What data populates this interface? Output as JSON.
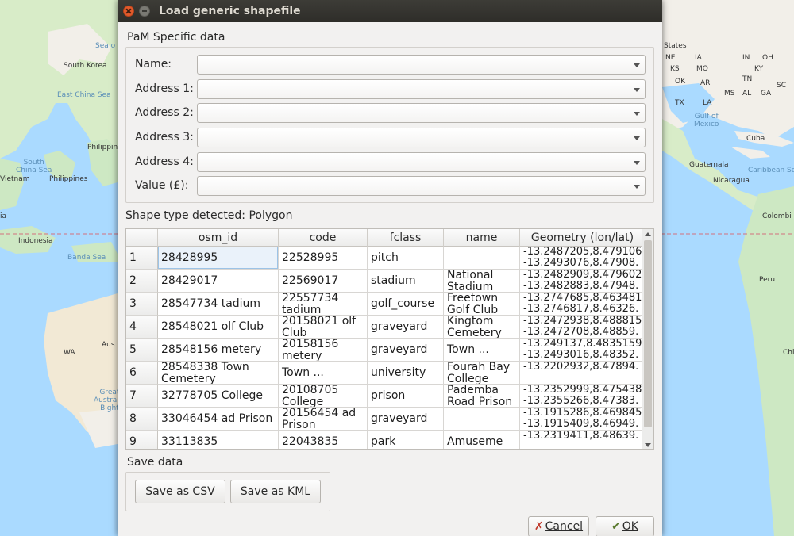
{
  "window": {
    "title": "Load generic shapefile"
  },
  "map": {
    "labels": {
      "sea_of_japan": "Sea o",
      "south_korea": "South Korea",
      "east_china_sea": "East China Sea",
      "philippine": "Philippin",
      "south_china_sea": "South\nChina Sea",
      "vietnam": "Vietnam",
      "philippines": "Philippines",
      "indonesia": "Indonesia",
      "banda_sea": "Banda Sea",
      "aus": "Aus",
      "wa": "WA",
      "great_australian_bight": "Great\nAustralia\nBight",
      "states": "States",
      "ne": "NE",
      "ia": "IA",
      "ks": "KS",
      "mo": "MO",
      "ok": "OK",
      "ar": "AR",
      "tx": "TX",
      "la": "LA",
      "in": "IN",
      "oh": "OH",
      "ky": "KY",
      "tn": "TN",
      "ms": "MS",
      "al": "AL",
      "ga": "GA",
      "sc": "SC",
      "gulf_of_mexico": "Gulf of\nMexico",
      "cuba": "Cuba",
      "guatemala": "Guatemala",
      "caribbean_sea": "Caribbean Se",
      "nicaragua": "Nicaragua",
      "colombi": "Colombi",
      "peru": "Peru",
      "chi": "Chi",
      "ia_left": "ia"
    }
  },
  "pam": {
    "group_title": "PaM Specific data",
    "fields": [
      {
        "label": "Name:",
        "value": ""
      },
      {
        "label": "Address 1:",
        "value": ""
      },
      {
        "label": "Address 2:",
        "value": ""
      },
      {
        "label": "Address 3:",
        "value": ""
      },
      {
        "label": "Address 4:",
        "value": ""
      },
      {
        "label": "Value (£):",
        "value": ""
      }
    ]
  },
  "shape": {
    "label": "Shape type detected:",
    "value": "Polygon"
  },
  "table": {
    "columns": [
      "osm_id",
      "code",
      "fclass",
      "name",
      "Geometry (lon/lat)"
    ],
    "rows": [
      {
        "num": "1",
        "osm_id": "28428995",
        "code": "22528995",
        "fclass": "pitch",
        "name": "",
        "geometry": "-13.2487205,8.479106\n-13.2493076,8.47908."
      },
      {
        "num": "2",
        "osm_id": "28429017",
        "code": "22569017",
        "fclass": "stadium",
        "name": "National\nStadium",
        "geometry": "-13.2482909,8.479602\n-13.2482883,8.47948."
      },
      {
        "num": "3",
        "osm_id": "28547734  tadium",
        "code": "22557734\ntadium",
        "fclass": "golf_course",
        "name": "Freetown\nGolf Club",
        "geometry": "-13.2747685,8.463481\n-13.2746817,8.46326."
      },
      {
        "num": "4",
        "osm_id": "28548021  olf Club",
        "code": "20158021  olf\nClub",
        "fclass": "graveyard",
        "name": "Kingtom\nCemetery",
        "geometry": "-13.2472938,8.488815\n-13.2472708,8.48859."
      },
      {
        "num": "5",
        "osm_id": "28548156  metery",
        "code": "20158156\nmetery",
        "fclass": "graveyard",
        "name": "Town ...",
        "geometry": "-13.249137,8.4835159\n-13.2493016,8.48352."
      },
      {
        "num": "6",
        "osm_id": "28548338  Town\nCemetery",
        "code": "Town ...",
        "fclass": "university",
        "name": "Fourah Bay\nCollege",
        "geometry": "-13.2202932,8.47894."
      },
      {
        "num": "7",
        "osm_id": "32778705   College",
        "code": "20108705\nCollege",
        "fclass": "prison",
        "name": "Pademba\nRoad Prison",
        "geometry": "-13.2352999,8.475438\n-13.2355266,8.47383."
      },
      {
        "num": "8",
        "osm_id": "33046454  ad Prison",
        "code": "20156454  ad\nPrison",
        "fclass": "graveyard",
        "name": "",
        "geometry": "-13.1915286,8.469845\n-13.1915409,8.46949."
      },
      {
        "num": "9",
        "osm_id": "33113835",
        "code": "22043835",
        "fclass": "park",
        "name": "Amuseme",
        "geometry": "-13.2319411,8.48639."
      }
    ]
  },
  "save": {
    "group_title": "Save data",
    "csv_label": "Save as CSV",
    "kml_label": "Save as KML"
  },
  "footer": {
    "cancel_label": "Cancel",
    "ok_label": "OK"
  },
  "colors": {
    "water": "#aadaff",
    "land": "#f2efe9",
    "forest": "#cde8c3",
    "dialog": "#f2f1f0",
    "titlebar": "#2e2d29",
    "close_button": "#e25a2b",
    "equator": "#d4707c"
  }
}
